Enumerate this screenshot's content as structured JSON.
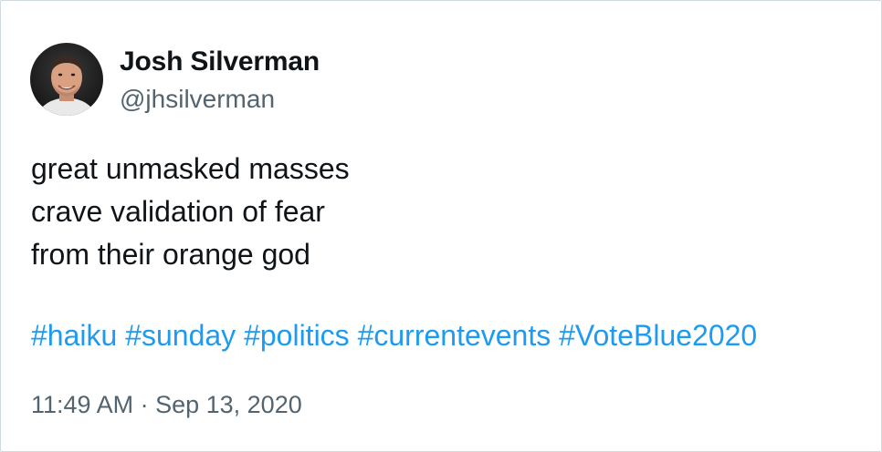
{
  "author": {
    "name": "Josh Silverman",
    "handle": "@jhsilverman"
  },
  "tweet": {
    "lines": [
      "great unmasked masses",
      "crave validation of fear",
      "from their orange god"
    ],
    "hashtags": [
      "#haiku",
      "#sunday",
      "#politics",
      "#currentevents",
      "#VoteBlue2020"
    ]
  },
  "meta": {
    "time": "11:49 AM",
    "separator": " · ",
    "date": "Sep 13, 2020"
  },
  "colors": {
    "text": "#0f1419",
    "secondary": "#536471",
    "link": "#1d9bf0",
    "border": "#cfd9de"
  }
}
